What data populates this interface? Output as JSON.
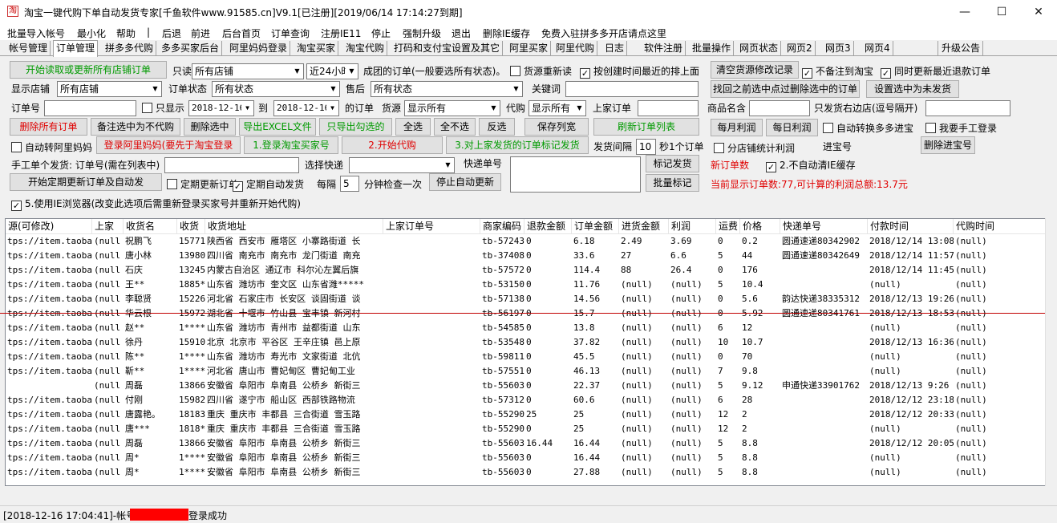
{
  "window": {
    "title": "淘宝一键代购下单自动发货专家[千鱼软件www.91585.cn]V9.1[已注册][2019/06/14 17:14:27到期]",
    "icon_glyph": "淘",
    "minimize": "—",
    "maximize": "☐",
    "close": "✕"
  },
  "menu": [
    "批量导入帐号",
    "最小化",
    "帮助",
    "|",
    "后退",
    "前进",
    "后台首页",
    "订单查询",
    "注册IE11",
    "停止",
    "强制升级",
    "退出",
    "删除IE缓存",
    "免费入驻拼多多开店请点这里"
  ],
  "tabs": [
    "帐号管理",
    "订单管理",
    "拼多多代购",
    "多多买家后台",
    "阿里妈妈登录",
    "淘宝买家",
    "淘宝代购",
    "打码和支付宝设置及其它",
    "阿里买家",
    "阿里代购",
    "日志",
    "软件注册",
    "批量操作",
    "网页状态",
    "网页2",
    "网页3",
    "网页4",
    "",
    "升级公告"
  ],
  "active_tab_index": 1,
  "controls": {
    "btn_read_orders": "开始读取或更新所有店铺订单",
    "only_label": "只读",
    "shop_filter": "所有店铺",
    "time_range": "近24小时",
    "success_note": "成团的订单(一般要选所有状态)。",
    "cb_source_update": "货源重新读",
    "cb_sort_by_time": "按创建时间最近的排上面",
    "btn_clear_source": "清空货源修改记录",
    "cb_no_remark": "不备注到淘宝",
    "cb_update_refund": "同时更新最近退款订单",
    "display_shop_label": "显示店铺",
    "display_shop": "所有店铺",
    "order_status_label": "订单状态",
    "order_status": "所有状态",
    "after_sale_label": "售后",
    "after_sale": "所有状态",
    "keyword_label": "关键词",
    "keyword": "",
    "btn_find_deleted": "找回之前选中点过删除选中的订单",
    "btn_set_unshipped": "设置选中为未发货",
    "order_no_label": "订单号",
    "order_no": "",
    "cb_only_show": "只显示",
    "date_from": "2018-12-16",
    "to_label": "到",
    "date_to": "2018-12-16",
    "orders_of_label": "的订单",
    "source_label": "货源",
    "source": "显示所有",
    "purchase_label": "代购",
    "purchase": "显示所有",
    "supplier_order_label": "上家订单",
    "supplier_order": "",
    "product_name_label": "商品名含",
    "product_name": "",
    "ship_right_shop_label": "只发货右边店(逗号隔开)",
    "ship_right_shop": "",
    "btn_delete_all": "删除所有订单",
    "btn_remark_no_purchase": "备注选中为不代购",
    "btn_delete_selected": "删除选中",
    "btn_export_excel": "导出EXCEL文件",
    "btn_export_checked": "只导出勾选的",
    "btn_select_all": "全选",
    "btn_select_none": "全不选",
    "btn_invert": "反选",
    "btn_save_width": "保存列宽",
    "btn_refresh": "刷新订单列表",
    "btn_monthly_profit": "每月利润",
    "btn_daily_profit": "每日利润",
    "cb_auto_convert_pdd": "自动转换多多进宝",
    "cb_manual_login": "我要手工登录",
    "cb_auto_alimama": "自动转阿里妈妈",
    "btn_login_alimama": "登录阿里妈妈(要先于淘宝登录",
    "btn_step1": "1.登录淘宝买家号",
    "btn_step2": "2.开始代购",
    "btn_step3": "3.对上家发货的订单标记发货",
    "ship_interval_label": "发货间隔",
    "ship_interval": "10",
    "per_order_label": "秒1个订单",
    "cb_per_shop_profit": "分店铺统计利润",
    "pdd_jinbao_label": "进宝号",
    "btn_delete_jinbao": "删除进宝号",
    "manual_ship_label": "手工单个发货: 订单号(需在列表中)",
    "manual_ship_order": "",
    "choose_express_label": "选择快递",
    "choose_express": "",
    "express_no_label": "快递单号",
    "express_no": "",
    "btn_mark_shipped": "标记发货",
    "btn_batch_mark": "批量标记",
    "new_orders_label": "新订单数",
    "cb_no_auto_clear": "2.不自动清IE缓存",
    "btn_timed_update": "开始定期更新订单及自动发",
    "cb_timed_update": "定期更新订单",
    "cb_timed_ship": "定期自动发货",
    "every_label": "每隔",
    "every_value": "5",
    "check_unit": "分钟检查一次",
    "btn_stop_auto": "停止自动更新",
    "current_orders_info": "当前显示订单数:77,可计算的利润总额:13.7元",
    "cb_use_ie": "5.使用IE浏览器(改变此选项后需重新登录买家号并重新开始代购)"
  },
  "table": {
    "headers": [
      "源(可修改)",
      "上家",
      "收货名",
      "收货",
      "收货地址",
      "上家订单号",
      "商家编码",
      "退款金额",
      "订单金额",
      "进货金额",
      "利润",
      "运费",
      "价格",
      "快递单号",
      "付款时间",
      "代购时间"
    ],
    "rows": [
      [
        "tps://item.taoba",
        "(null",
        "祝鹏飞",
        "15771",
        "陕西省 西安市 雁塔区 小寨路街道 长",
        "",
        "tb-57243",
        "0",
        "6.18",
        "2.49",
        "3.69",
        "0",
        "0.2",
        "圆通速递80342902",
        "2018/12/14 13:08",
        "(null)"
      ],
      [
        "tps://item.taoba",
        "(null",
        "唐小林",
        "13980",
        "四川省 南充市 南充市 龙门街道 南充",
        "",
        "tb-37408",
        "0",
        "33.6",
        "27",
        "6.6",
        "5",
        "44",
        "圆通速递80342649",
        "2018/12/14 11:57",
        "(null)"
      ],
      [
        "tps://item.taoba",
        "(null",
        "石庆",
        "13245",
        "内蒙古自治区 通辽市 科尔沁左翼后旗",
        "",
        "tb-57572",
        "0",
        "114.4",
        "88",
        "26.4",
        "0",
        "176",
        "",
        "2018/12/14 11:45",
        "(null)"
      ],
      [
        "tps://item.taoba",
        "(null",
        "王**",
        "1885*",
        "山东省 潍坊市 奎文区 山东省潍*****",
        "",
        "tb-53150",
        "0",
        "11.76",
        "(null)",
        "(null)",
        "5",
        "10.4",
        "",
        "(null)",
        "(null)"
      ],
      [
        "tps://item.taoba",
        "(null",
        "李聪贤",
        "15226",
        "河北省 石家庄市 长安区 谈固街道 谈",
        "",
        "tb-57138",
        "0",
        "14.56",
        "(null)",
        "(null)",
        "0",
        "5.6",
        "韵达快递38335312",
        "2018/12/13 19:26",
        "(null)"
      ],
      [
        "tps://item.taoba",
        "(null",
        "华云根",
        "15972",
        "湖北省 十堰市 竹山县 宝丰镇 新河村",
        "",
        "tb-56197",
        "0",
        "15.7",
        "(null)",
        "(null)",
        "0",
        "5.92",
        "圆通速递80341761",
        "2018/12/13 18:53",
        "(null)"
      ],
      [
        "tps://item.taoba",
        "(null",
        "赵**",
        "1****",
        "山东省 潍坊市 青州市 益都街道 山东",
        "",
        "tb-54585",
        "0",
        "13.8",
        "(null)",
        "(null)",
        "6",
        "12",
        "",
        "(null)",
        "(null)"
      ],
      [
        "tps://item.taoba",
        "(null",
        "徐丹",
        "15910",
        "北京 北京市 平谷区 王辛庄镇 邑上原",
        "",
        "tb-53548",
        "0",
        "37.82",
        "(null)",
        "(null)",
        "10",
        "10.7",
        "",
        "2018/12/13 16:36",
        "(null)"
      ],
      [
        "tps://item.taoba",
        "(null",
        "陈**",
        "1****",
        "山东省 潍坊市 寿光市 文家街道 北伉",
        "",
        "tb-59811",
        "0",
        "45.5",
        "(null)",
        "(null)",
        "0",
        "70",
        "",
        "(null)",
        "(null)"
      ],
      [
        "tps://item.taoba",
        "(null",
        "靳**",
        "1****",
        "河北省 唐山市 曹妃甸区 曹妃甸工业",
        "",
        "tb-57551",
        "0",
        "46.13",
        "(null)",
        "(null)",
        "7",
        "9.8",
        "",
        "(null)",
        "(null)"
      ],
      [
        "",
        "(null",
        "周磊",
        "13866",
        "安徽省 阜阳市 阜南县 公桥乡 新街三",
        "",
        "tb-55603",
        "0",
        "22.37",
        "(null)",
        "(null)",
        "5",
        "9.12",
        "申通快递33901762",
        "2018/12/13 9:26",
        "(null)"
      ],
      [
        "tps://item.taoba",
        "(null",
        "付刚",
        "15982",
        "四川省 遂宁市 船山区 西部铁路物流",
        "",
        "tb-57312",
        "0",
        "60.6",
        "(null)",
        "(null)",
        "6",
        "28",
        "",
        "2018/12/12 23:18",
        "(null)"
      ],
      [
        "tps://item.taoba",
        "(null",
        "唐露艳。",
        "18183",
        "重庆 重庆市 丰都县 三合街道 雪玉路",
        "",
        "tb-55290",
        "25",
        "25",
        "(null)",
        "(null)",
        "12",
        "2",
        "",
        "2018/12/12 20:33",
        "(null)"
      ],
      [
        "tps://item.taoba",
        "(null",
        "唐***",
        "1818*",
        "重庆 重庆市 丰都县 三合街道 雪玉路",
        "",
        "tb-55290",
        "0",
        "25",
        "(null)",
        "(null)",
        "12",
        "2",
        "",
        "(null)",
        "(null)"
      ],
      [
        "tps://item.taoba",
        "(null",
        "周磊",
        "13866",
        "安徽省 阜阳市 阜南县 公桥乡 新街三",
        "",
        "tb-55603",
        "16.44",
        "16.44",
        "(null)",
        "(null)",
        "5",
        "8.8",
        "",
        "2018/12/12 20:05",
        "(null)"
      ],
      [
        "tps://item.taoba",
        "(null",
        "周*",
        "1****",
        "安徽省 阜阳市 阜南县 公桥乡 新街三",
        "",
        "tb-55603",
        "0",
        "16.44",
        "(null)",
        "(null)",
        "5",
        "8.8",
        "",
        "(null)",
        "(null)"
      ],
      [
        "tps://item.taoba",
        "(null",
        "周*",
        "1****",
        "安徽省 阜阳市 阜南县 公桥乡 新街三",
        "",
        "tb-55603",
        "0",
        "27.88",
        "(null)",
        "(null)",
        "5",
        "8.8",
        "",
        "(null)",
        "(null)"
      ]
    ]
  },
  "status": {
    "prefix": "[2018-12-16 17:04:41]-帐号",
    "suffix": "登录成功",
    "redacted_color": "#ff0000"
  },
  "colors": {
    "green_text": "#009a00",
    "red_text": "#e00000",
    "grid_line": "#c00000"
  }
}
